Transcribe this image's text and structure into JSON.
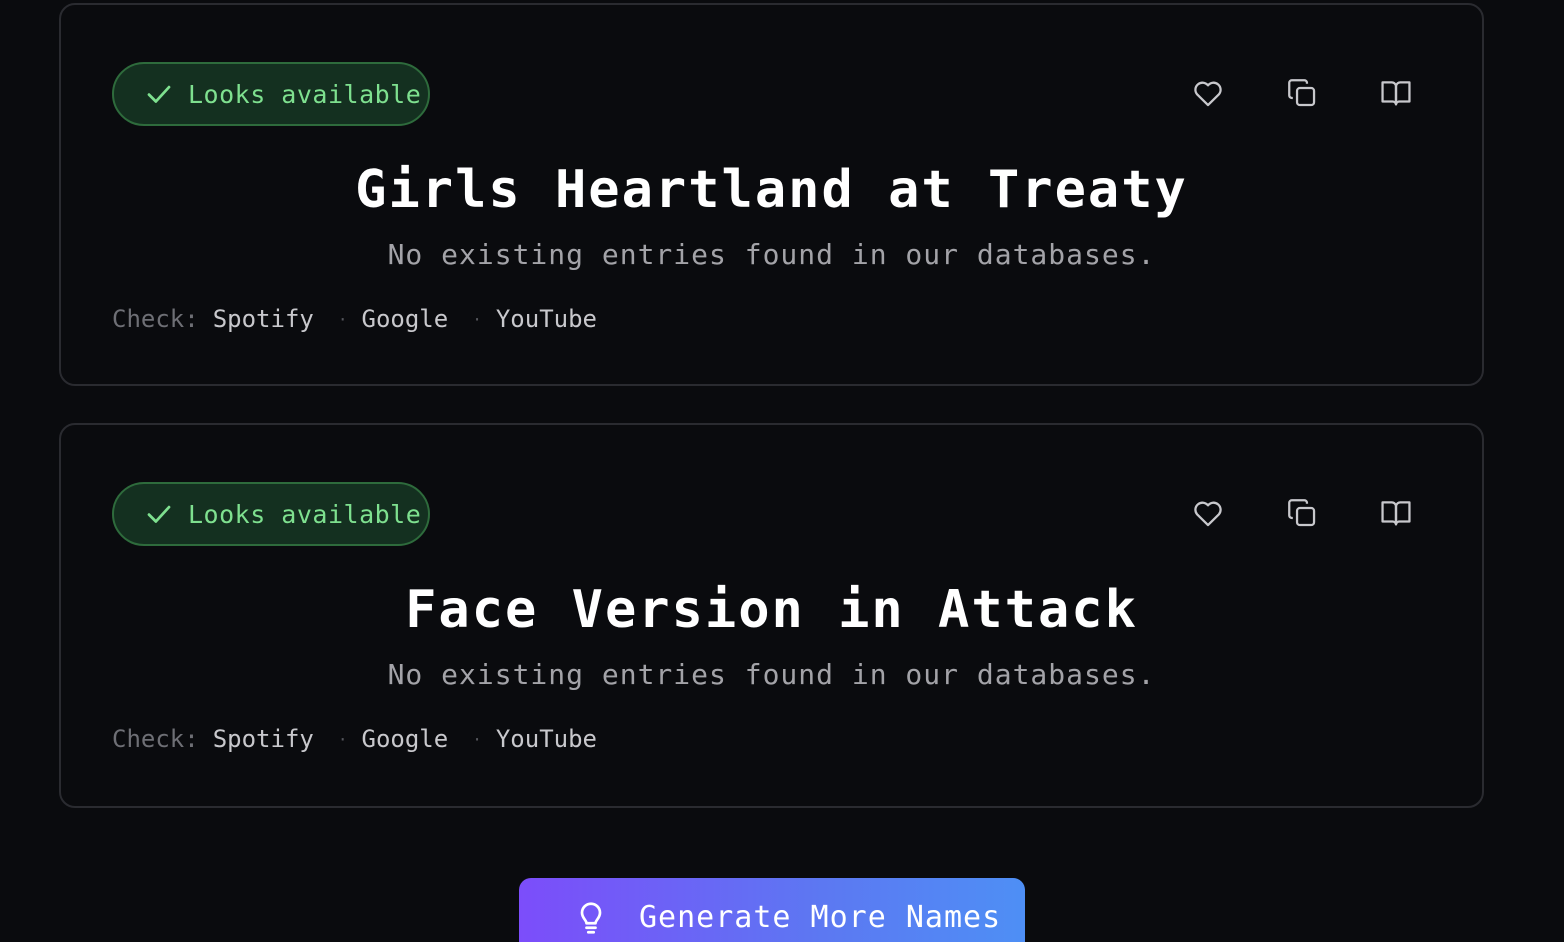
{
  "cards": [
    {
      "badge": "Looks available",
      "name": "Girls Heartland at Treaty",
      "subtitle": "No existing entries found in our databases.",
      "check_label": "Check:",
      "links": [
        "Spotify",
        "Google",
        "YouTube"
      ]
    },
    {
      "badge": "Looks available",
      "name": "Face Version in Attack",
      "subtitle": "No existing entries found in our databases.",
      "check_label": "Check:",
      "links": [
        "Spotify",
        "Google",
        "YouTube"
      ]
    }
  ],
  "action_icons": [
    "heart-icon",
    "copy-icon",
    "book-icon"
  ],
  "generate_button": {
    "label": "Generate More Names",
    "icon": "lightbulb-icon"
  },
  "colors": {
    "background": "#0a0b0e",
    "badge_bg": "#143020",
    "badge_text": "#7ee08f",
    "button_gradient_start": "#7c4dfa",
    "button_gradient_end": "#4e8ff5"
  }
}
